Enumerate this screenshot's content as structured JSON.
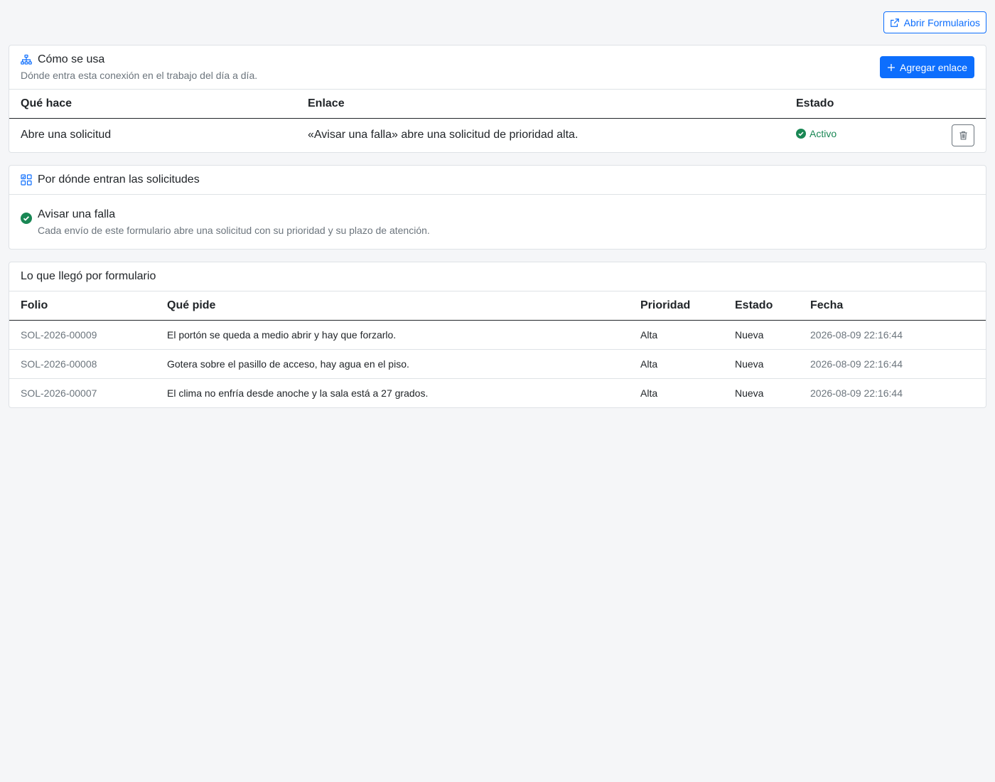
{
  "toolbar": {
    "open_forms_label": "Abrir Formularios"
  },
  "usage": {
    "title": "Cómo se usa",
    "subtitle": "Dónde entra esta conexión en el trabajo del día a día.",
    "add_link_label": "Agregar enlace",
    "columns": [
      "Qué hace",
      "Enlace",
      "Estado"
    ],
    "rows": [
      {
        "action": "Abre una solicitud",
        "link": "«Avisar una falla» abre una solicitud de prioridad alta.",
        "status": "Activo"
      }
    ]
  },
  "sources": {
    "title": "Por dónde entran las solicitudes",
    "items": [
      {
        "name": "Avisar una falla",
        "description": "Cada envío de este formulario abre una solicitud con su prioridad y su plazo de atención."
      }
    ]
  },
  "received": {
    "title": "Lo que llegó por formulario",
    "columns": [
      "Folio",
      "Qué pide",
      "Prioridad",
      "Estado",
      "Fecha"
    ],
    "rows": [
      {
        "folio": "SOL-2026-00009",
        "request": "El portón se queda a medio abrir y hay que forzarlo.",
        "priority": "Alta",
        "status": "Nueva",
        "date": "2026-08-09 22:16:44"
      },
      {
        "folio": "SOL-2026-00008",
        "request": "Gotera sobre el pasillo de acceso, hay agua en el piso.",
        "priority": "Alta",
        "status": "Nueva",
        "date": "2026-08-09 22:16:44"
      },
      {
        "folio": "SOL-2026-00007",
        "request": "El clima no enfría desde anoche y la sala está a 27 grados.",
        "priority": "Alta",
        "status": "Nueva",
        "date": "2026-08-09 22:16:44"
      }
    ]
  },
  "icons": {
    "open_forms": "external-link-icon",
    "usage": "diagram-icon",
    "add": "plus-icon",
    "active": "check-circle-icon",
    "delete": "trash-icon",
    "sources": "grid-icon",
    "source_ok": "check-circle-icon"
  },
  "colors": {
    "primary": "#0d6efd",
    "success": "#198754",
    "muted": "#6c757d",
    "background": "#f5f6f8"
  }
}
